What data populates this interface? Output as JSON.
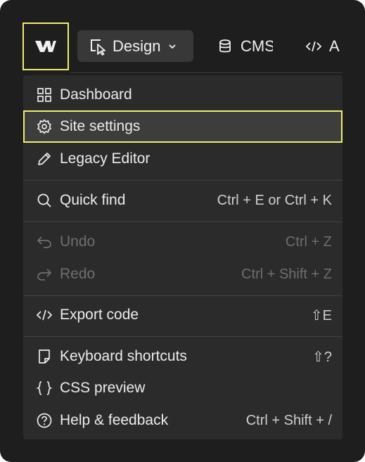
{
  "toolbar": {
    "logo_icon": "webflow-logo",
    "design_label": "Design",
    "cms_label": "CMS",
    "app_label": "A"
  },
  "menu": {
    "items": [
      {
        "label": "Dashboard",
        "icon": "grid-icon",
        "shortcut": ""
      },
      {
        "label": "Site settings",
        "icon": "gear-icon",
        "shortcut": ""
      },
      {
        "label": "Legacy Editor",
        "icon": "pencil-icon",
        "shortcut": ""
      },
      {
        "label": "Quick find",
        "icon": "search-icon",
        "shortcut": "Ctrl + E or Ctrl + K"
      },
      {
        "label": "Undo",
        "icon": "undo-icon",
        "shortcut": "Ctrl + Z"
      },
      {
        "label": "Redo",
        "icon": "redo-icon",
        "shortcut": "Ctrl + Shift + Z"
      },
      {
        "label": "Export code",
        "icon": "code-icon",
        "shortcut": "⇧E"
      },
      {
        "label": "Keyboard shortcuts",
        "icon": "document-icon",
        "shortcut": "⇧?"
      },
      {
        "label": "CSS preview",
        "icon": "braces-icon",
        "shortcut": ""
      },
      {
        "label": "Help & feedback",
        "icon": "help-icon",
        "shortcut": "Ctrl + Shift + /"
      }
    ]
  },
  "colors": {
    "highlight": "#f1ee6b",
    "menu_bg": "#2b2b2b",
    "frame_bg": "#1e1e1e"
  }
}
